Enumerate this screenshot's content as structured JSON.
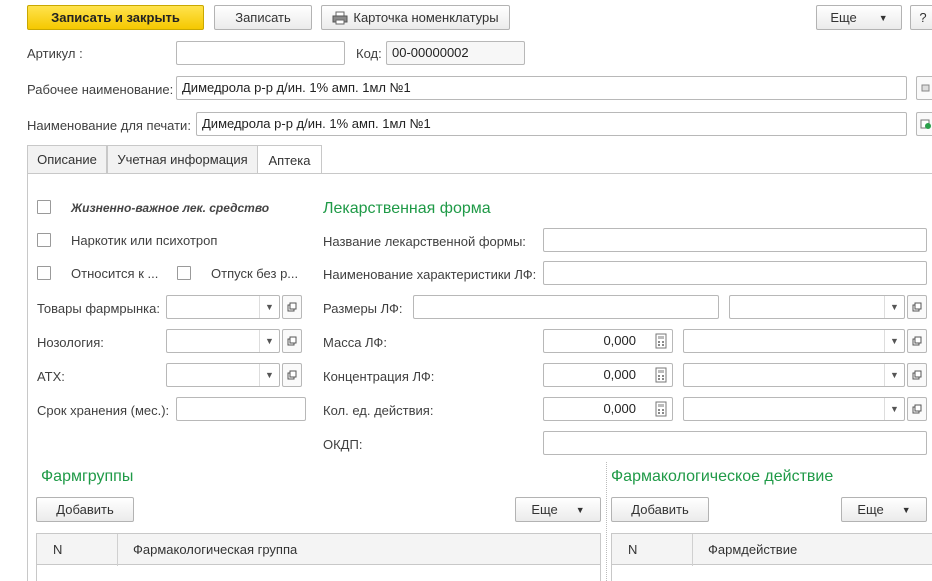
{
  "toolbar": {
    "save_close": "Записать и закрыть",
    "save": "Записать",
    "card": "Карточка номенклатуры",
    "more": "Еще",
    "help": "?"
  },
  "header": {
    "article_label": "Артикул :",
    "article_value": "",
    "code_label": "Код:",
    "code_value": "00-00000002",
    "work_name_label": "Рабочее наименование:",
    "work_name_value": "Димедрола р-р д/ин. 1% амп. 1мл №1",
    "print_name_label": "Наименование для печати:",
    "print_name_value": "Димедрола р-р д/ин. 1% амп. 1мл №1"
  },
  "tabs": [
    {
      "label": "Описание"
    },
    {
      "label": "Учетная информация"
    },
    {
      "label": "Аптека"
    }
  ],
  "pharmacy": {
    "vital_label": "Жизненно-важное лек. средство",
    "narcotic_label": "Наркотик или психотроп",
    "relates_label": "Относится к ...",
    "release_label": "Отпуск без р...",
    "goods_label": "Товары фармрынка:",
    "nosology_label": "Нозология:",
    "atc_label": "АТХ:",
    "shelf_label": "Срок хранения (мес.):",
    "form_title": "Лекарственная форма",
    "form_name_label": "Название лекарственной формы:",
    "form_char_label": "Наименование характеристики ЛФ:",
    "form_size_label": "Размеры ЛФ:",
    "mass_label": "Масса ЛФ:",
    "mass_value": "0,000",
    "conc_label": "Концентрация ЛФ:",
    "conc_value": "0,000",
    "units_label": "Кол. ед. действия:",
    "units_value": "0,000",
    "okdp_label": "ОКДП:"
  },
  "pharm_groups": {
    "title": "Фармгруппы",
    "add": "Добавить",
    "more": "Еще",
    "columns": [
      "N",
      "Фармакологическая группа"
    ]
  },
  "pharm_action": {
    "title": "Фармакологическое действие",
    "add": "Добавить",
    "more": "Еще",
    "columns": [
      "N",
      "Фармдействие"
    ]
  },
  "colors": {
    "primary_button": "#f5c800",
    "section_title": "#1f9a47"
  }
}
